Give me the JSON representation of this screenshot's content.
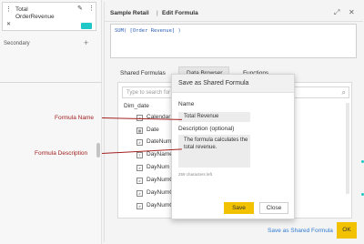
{
  "left_panel": {
    "measure_line1": "Total",
    "measure_line2": "OrderRevenue",
    "edit_icon": "✎",
    "menu_icon": "⋮",
    "delete_icon": "✕",
    "secondary_label": "Secondary",
    "add_icon": "+"
  },
  "annotations": {
    "formula_name": "Formula Name",
    "formula_description": "Formula Description"
  },
  "editor": {
    "breadcrumb_root": "Sample Retail",
    "breadcrumb_sep": "|",
    "breadcrumb_current": "Edit Formula",
    "expand_icon": "⤢",
    "close_icon": "✕",
    "formula": "SUM( [Order Revenue] )",
    "tabs": [
      "Shared Formulas",
      "Data Browser",
      "Functions"
    ],
    "search_placeholder": "Type to search for",
    "search_icon": "⌕",
    "group": "Dim_date",
    "fields": [
      "Calendar_O",
      "Date",
      "DateNum",
      "DayName",
      "DayNum",
      "DayNumOf",
      "DayNumOf",
      "DayNumOf"
    ],
    "field_icons": [
      "#",
      "▦",
      "#",
      "T",
      "#",
      "#",
      "#",
      "#"
    ],
    "save_shared_link": "Save as Shared Formula",
    "ok_label": "OK"
  },
  "save_dialog": {
    "title": "Save as Shared Formula",
    "name_label": "Name",
    "name_value": "Total Revenue",
    "description_label": "Description (optional)",
    "description_value": "The formula calculates the total revenue.",
    "chars_left": "259 characters left",
    "save_label": "Save",
    "close_label": "Close"
  },
  "colors": {
    "accent": "#f2c200",
    "teal": "#1fc7c7",
    "annotation": "#a32020",
    "link": "#2f7bd2"
  }
}
